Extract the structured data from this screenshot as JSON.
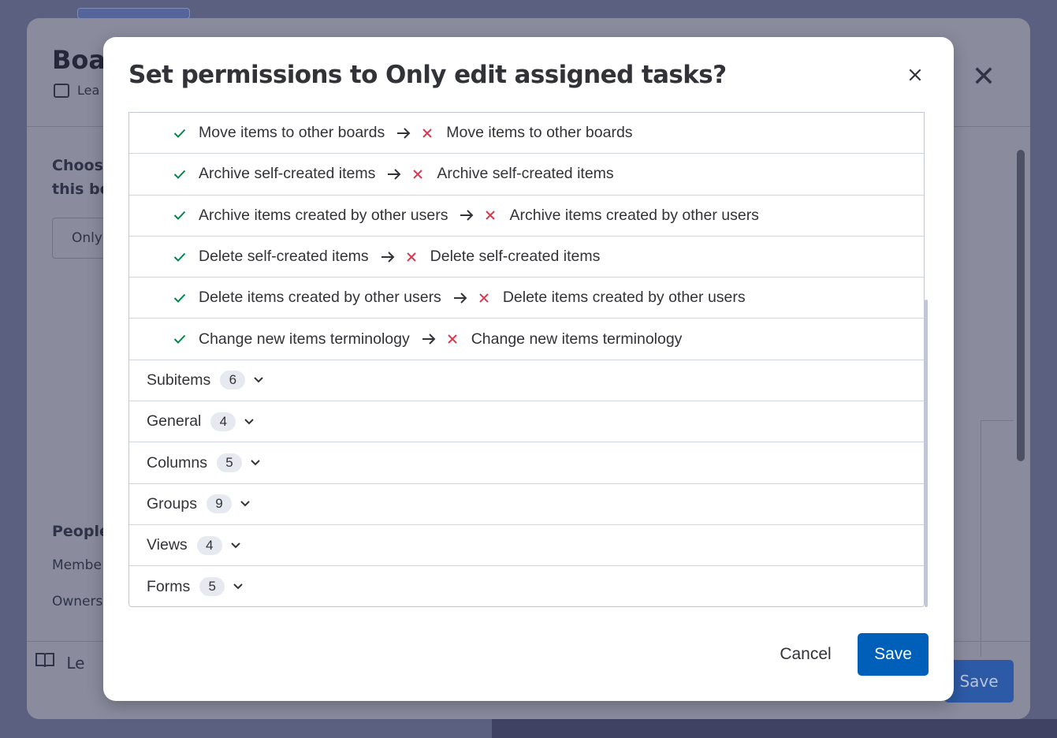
{
  "background": {
    "title": "Boa",
    "subtitle": "Lea",
    "choose_line1": "Choos",
    "choose_line2": "this bo",
    "only_field": "Only",
    "people_heading": "People",
    "member_label": "Membe",
    "owners_label": "Owners",
    "learn_label": "Le",
    "save_label": "Save"
  },
  "modal": {
    "title": "Set permissions to Only edit assigned tasks?",
    "permission_changes": [
      {
        "from": "Move items to other boards",
        "to": "Move items to other boards"
      },
      {
        "from": "Archive self-created items",
        "to": "Archive self-created items"
      },
      {
        "from": "Archive items created by other users",
        "to": "Archive items created by other users"
      },
      {
        "from": "Delete self-created items",
        "to": "Delete self-created items"
      },
      {
        "from": "Delete items created by other users",
        "to": "Delete items created by other users"
      },
      {
        "from": "Change new items terminology",
        "to": "Change new items terminology"
      }
    ],
    "categories": [
      {
        "label": "Subitems",
        "count": "6"
      },
      {
        "label": "General",
        "count": "4"
      },
      {
        "label": "Columns",
        "count": "5"
      },
      {
        "label": "Groups",
        "count": "9"
      },
      {
        "label": "Views",
        "count": "4"
      },
      {
        "label": "Forms",
        "count": "5"
      }
    ],
    "cancel_label": "Cancel",
    "save_label": "Save"
  },
  "colors": {
    "check": "#00854d",
    "cross": "#d83a52",
    "primary": "#0060b9"
  },
  "icons": {
    "allowed": "check-icon",
    "denied": "cross-icon",
    "transition": "arrow-right-icon",
    "expand": "chevron-down-icon",
    "close": "close-icon"
  }
}
